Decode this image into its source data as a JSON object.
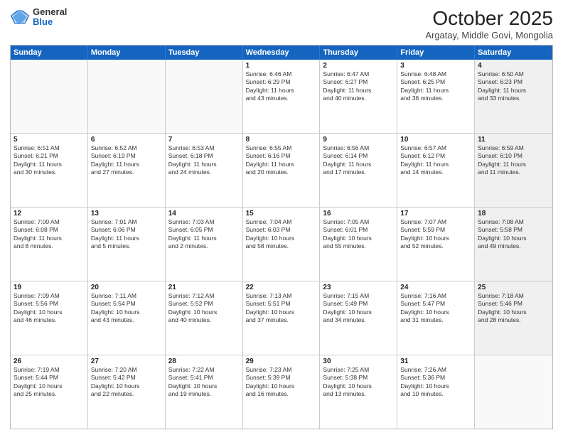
{
  "logo": {
    "general": "General",
    "blue": "Blue"
  },
  "header": {
    "month": "October 2025",
    "location": "Argatay, Middle Govi, Mongolia"
  },
  "day_headers": [
    "Sunday",
    "Monday",
    "Tuesday",
    "Wednesday",
    "Thursday",
    "Friday",
    "Saturday"
  ],
  "weeks": [
    [
      {
        "num": "",
        "info": "",
        "empty": true
      },
      {
        "num": "",
        "info": "",
        "empty": true
      },
      {
        "num": "",
        "info": "",
        "empty": true
      },
      {
        "num": "1",
        "info": "Sunrise: 6:46 AM\nSunset: 6:29 PM\nDaylight: 11 hours\nand 43 minutes."
      },
      {
        "num": "2",
        "info": "Sunrise: 6:47 AM\nSunset: 6:27 PM\nDaylight: 11 hours\nand 40 minutes."
      },
      {
        "num": "3",
        "info": "Sunrise: 6:48 AM\nSunset: 6:25 PM\nDaylight: 11 hours\nand 36 minutes."
      },
      {
        "num": "4",
        "info": "Sunrise: 6:50 AM\nSunset: 6:23 PM\nDaylight: 11 hours\nand 33 minutes.",
        "shaded": true
      }
    ],
    [
      {
        "num": "5",
        "info": "Sunrise: 6:51 AM\nSunset: 6:21 PM\nDaylight: 11 hours\nand 30 minutes."
      },
      {
        "num": "6",
        "info": "Sunrise: 6:52 AM\nSunset: 6:19 PM\nDaylight: 11 hours\nand 27 minutes."
      },
      {
        "num": "7",
        "info": "Sunrise: 6:53 AM\nSunset: 6:18 PM\nDaylight: 11 hours\nand 24 minutes."
      },
      {
        "num": "8",
        "info": "Sunrise: 6:55 AM\nSunset: 6:16 PM\nDaylight: 11 hours\nand 20 minutes."
      },
      {
        "num": "9",
        "info": "Sunrise: 6:56 AM\nSunset: 6:14 PM\nDaylight: 11 hours\nand 17 minutes."
      },
      {
        "num": "10",
        "info": "Sunrise: 6:57 AM\nSunset: 6:12 PM\nDaylight: 11 hours\nand 14 minutes."
      },
      {
        "num": "11",
        "info": "Sunrise: 6:59 AM\nSunset: 6:10 PM\nDaylight: 11 hours\nand 11 minutes.",
        "shaded": true
      }
    ],
    [
      {
        "num": "12",
        "info": "Sunrise: 7:00 AM\nSunset: 6:08 PM\nDaylight: 11 hours\nand 8 minutes."
      },
      {
        "num": "13",
        "info": "Sunrise: 7:01 AM\nSunset: 6:06 PM\nDaylight: 11 hours\nand 5 minutes."
      },
      {
        "num": "14",
        "info": "Sunrise: 7:03 AM\nSunset: 6:05 PM\nDaylight: 11 hours\nand 2 minutes."
      },
      {
        "num": "15",
        "info": "Sunrise: 7:04 AM\nSunset: 6:03 PM\nDaylight: 10 hours\nand 58 minutes."
      },
      {
        "num": "16",
        "info": "Sunrise: 7:05 AM\nSunset: 6:01 PM\nDaylight: 10 hours\nand 55 minutes."
      },
      {
        "num": "17",
        "info": "Sunrise: 7:07 AM\nSunset: 5:59 PM\nDaylight: 10 hours\nand 52 minutes."
      },
      {
        "num": "18",
        "info": "Sunrise: 7:08 AM\nSunset: 5:58 PM\nDaylight: 10 hours\nand 49 minutes.",
        "shaded": true
      }
    ],
    [
      {
        "num": "19",
        "info": "Sunrise: 7:09 AM\nSunset: 5:56 PM\nDaylight: 10 hours\nand 46 minutes."
      },
      {
        "num": "20",
        "info": "Sunrise: 7:11 AM\nSunset: 5:54 PM\nDaylight: 10 hours\nand 43 minutes."
      },
      {
        "num": "21",
        "info": "Sunrise: 7:12 AM\nSunset: 5:52 PM\nDaylight: 10 hours\nand 40 minutes."
      },
      {
        "num": "22",
        "info": "Sunrise: 7:13 AM\nSunset: 5:51 PM\nDaylight: 10 hours\nand 37 minutes."
      },
      {
        "num": "23",
        "info": "Sunrise: 7:15 AM\nSunset: 5:49 PM\nDaylight: 10 hours\nand 34 minutes."
      },
      {
        "num": "24",
        "info": "Sunrise: 7:16 AM\nSunset: 5:47 PM\nDaylight: 10 hours\nand 31 minutes."
      },
      {
        "num": "25",
        "info": "Sunrise: 7:18 AM\nSunset: 5:46 PM\nDaylight: 10 hours\nand 28 minutes.",
        "shaded": true
      }
    ],
    [
      {
        "num": "26",
        "info": "Sunrise: 7:19 AM\nSunset: 5:44 PM\nDaylight: 10 hours\nand 25 minutes."
      },
      {
        "num": "27",
        "info": "Sunrise: 7:20 AM\nSunset: 5:42 PM\nDaylight: 10 hours\nand 22 minutes."
      },
      {
        "num": "28",
        "info": "Sunrise: 7:22 AM\nSunset: 5:41 PM\nDaylight: 10 hours\nand 19 minutes."
      },
      {
        "num": "29",
        "info": "Sunrise: 7:23 AM\nSunset: 5:39 PM\nDaylight: 10 hours\nand 16 minutes."
      },
      {
        "num": "30",
        "info": "Sunrise: 7:25 AM\nSunset: 5:38 PM\nDaylight: 10 hours\nand 13 minutes."
      },
      {
        "num": "31",
        "info": "Sunrise: 7:26 AM\nSunset: 5:36 PM\nDaylight: 10 hours\nand 10 minutes."
      },
      {
        "num": "",
        "info": "",
        "empty": true,
        "shaded": true
      }
    ]
  ]
}
